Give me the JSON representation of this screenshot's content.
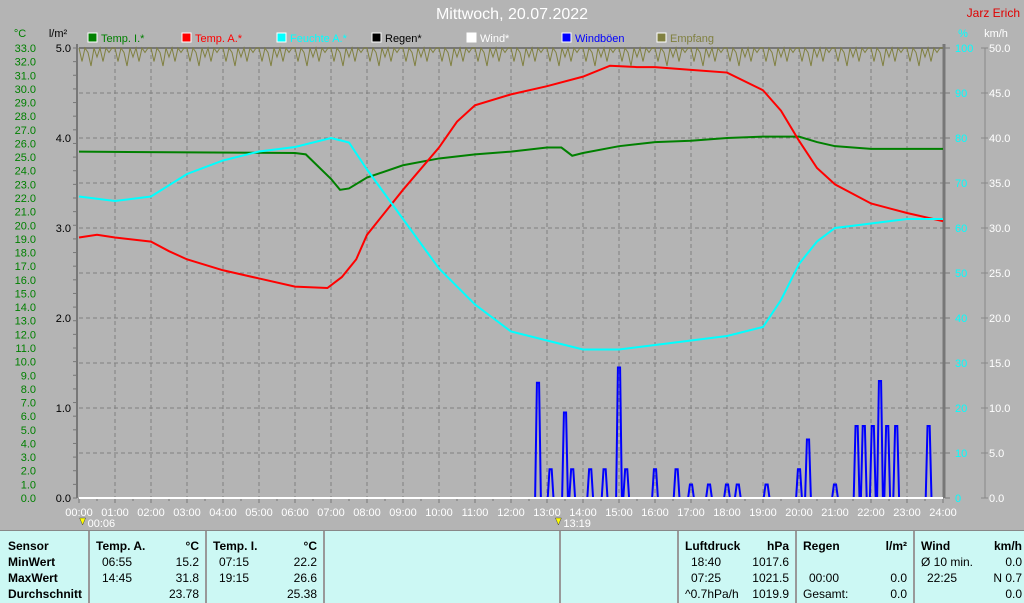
{
  "header": {
    "title": "Mittwoch, 20.07.2022",
    "author": "Jarz Erich"
  },
  "chart_data": {
    "type": "line",
    "title": "Mittwoch, 20.07.2022",
    "x_label_ticks": [
      "00:00",
      "01:00",
      "02:00",
      "03:00",
      "04:00",
      "05:00",
      "06:00",
      "07:00",
      "08:00",
      "09:00",
      "10:00",
      "11:00",
      "12:00",
      "13:00",
      "14:00",
      "15:00",
      "16:00",
      "17:00",
      "18:00",
      "19:00",
      "20:00",
      "21:00",
      "22:00",
      "23:00",
      "24:00"
    ],
    "xlim": [
      0,
      24
    ],
    "axes": {
      "temp": {
        "unit": "°C",
        "range": [
          0,
          33
        ],
        "ticks": [
          "0.0",
          "1.0",
          "2.0",
          "3.0",
          "4.0",
          "5.0",
          "6.0",
          "7.0",
          "8.0",
          "9.0",
          "10.0",
          "11.0",
          "12.0",
          "13.0",
          "14.0",
          "15.0",
          "16.0",
          "17.0",
          "18.0",
          "19.0",
          "20.0",
          "21.0",
          "22.0",
          "23.0",
          "24.0",
          "25.0",
          "26.0",
          "27.0",
          "28.0",
          "29.0",
          "30.0",
          "31.0",
          "32.0",
          "33.0"
        ]
      },
      "rain": {
        "unit": "l/m²",
        "range": [
          0,
          5
        ],
        "ticks": [
          "0.0",
          "1.0",
          "2.0",
          "3.0",
          "4.0",
          "5.0"
        ]
      },
      "humidity": {
        "unit": "%",
        "range": [
          0,
          100
        ],
        "ticks": [
          "0",
          "10",
          "20",
          "30",
          "40",
          "50",
          "60",
          "70",
          "80",
          "90",
          "100"
        ]
      },
      "wind": {
        "unit": "km/h",
        "range": [
          0,
          50
        ],
        "ticks": [
          "0.0",
          "5.0",
          "10.0",
          "15.0",
          "20.0",
          "25.0",
          "30.0",
          "35.0",
          "40.0",
          "45.0",
          "50.0"
        ]
      }
    },
    "legend": [
      {
        "label": "Temp. I.*",
        "color": "#008000"
      },
      {
        "label": "Temp. A.*",
        "color": "#ff0000"
      },
      {
        "label": "Feuchte A.*",
        "color": "#00ffff"
      },
      {
        "label": "Regen*",
        "color": "#000000"
      },
      {
        "label": "Wind*",
        "color": "#ffffff"
      },
      {
        "label": "Windböen",
        "color": "#0000ff"
      },
      {
        "label": "Empfang",
        "color": "#808040"
      }
    ],
    "series": [
      {
        "name": "Temp. I.*",
        "axis": "temp",
        "color": "#008000",
        "x": [
          0,
          6,
          6.3,
          7,
          7.25,
          7.5,
          8,
          9,
          10,
          11,
          12,
          13,
          13.4,
          13.7,
          14,
          15,
          16,
          17,
          18,
          19,
          20,
          20.5,
          21,
          22,
          24
        ],
        "y": [
          25.4,
          25.3,
          25.2,
          23.4,
          22.6,
          22.7,
          23.5,
          24.4,
          24.9,
          25.2,
          25.4,
          25.7,
          25.7,
          25.1,
          25.3,
          25.8,
          26.1,
          26.2,
          26.4,
          26.5,
          26.5,
          26.1,
          25.8,
          25.6,
          25.6
        ]
      },
      {
        "name": "Temp. A.*",
        "axis": "temp",
        "color": "#ff0000",
        "x": [
          0,
          0.5,
          1,
          2,
          2.5,
          3,
          4,
          5,
          6,
          6.9,
          7.3,
          7.7,
          8,
          9,
          10,
          10.5,
          11,
          12,
          13,
          14,
          14.75,
          15.5,
          16,
          17,
          18,
          19,
          19.5,
          20,
          20.5,
          21,
          22,
          23,
          24
        ],
        "y": [
          19.1,
          19.3,
          19.1,
          18.8,
          18.1,
          17.5,
          16.7,
          16.1,
          15.5,
          15.4,
          16.2,
          17.5,
          19.3,
          22.6,
          25.7,
          27.6,
          28.8,
          29.6,
          30.2,
          30.9,
          31.7,
          31.6,
          31.6,
          31.4,
          31.2,
          29.9,
          28.4,
          26.2,
          24.2,
          23.0,
          21.6,
          20.9,
          20.3
        ]
      },
      {
        "name": "Feuchte A.*",
        "axis": "humidity",
        "color": "#00ffff",
        "x": [
          0,
          1,
          2,
          3,
          4,
          5,
          6,
          7,
          7.5,
          8,
          9,
          10,
          11,
          12,
          13,
          14,
          15,
          16,
          17,
          18,
          19,
          19.5,
          20,
          20.5,
          21,
          22,
          23,
          24
        ],
        "y": [
          67,
          66,
          67,
          72,
          75,
          77,
          78,
          80,
          79,
          73,
          62,
          51,
          43,
          37,
          35,
          33,
          33,
          34,
          35,
          36,
          38,
          44,
          52,
          57,
          60,
          61,
          62,
          62
        ]
      },
      {
        "name": "Regen*",
        "axis": "rain",
        "color": "#000000",
        "x": [
          0,
          24
        ],
        "y": [
          0,
          0
        ]
      },
      {
        "name": "Windböen",
        "axis": "wind",
        "color": "#0000ff",
        "peaks_x": [
          12.75,
          13.1,
          13.5,
          13.7,
          14.2,
          14.6,
          15,
          15.2,
          16,
          16.6,
          17,
          17.5,
          18,
          18.3,
          19.1,
          20,
          20.25,
          21,
          21.6,
          21.8,
          22.05,
          22.25,
          22.45,
          22.7,
          23.6
        ],
        "peaks_y": [
          12.8,
          3.2,
          9.5,
          3.2,
          3.2,
          3.2,
          14.5,
          3.2,
          3.2,
          3.2,
          1.5,
          1.5,
          1.5,
          1.5,
          1.5,
          3.2,
          6.5,
          1.5,
          8,
          8,
          8,
          13,
          8,
          8,
          8
        ]
      },
      {
        "name": "Wind*",
        "axis": "wind",
        "color": "#ffffff",
        "x": [
          0,
          24
        ],
        "y": [
          0,
          0
        ]
      },
      {
        "name": "Empfang",
        "axis": "humidity",
        "color": "#808040",
        "pattern": [
          100,
          97,
          100,
          99,
          96,
          100,
          98,
          100,
          97,
          100,
          99,
          100
        ]
      }
    ],
    "markers": [
      {
        "time": "00:06",
        "label": "00:06"
      },
      {
        "time": "13:19",
        "label": "13:19"
      }
    ]
  },
  "table": {
    "sensor": {
      "h": "Sensor",
      "min": "MinWert",
      "max": "MaxWert",
      "avg": "Durchschnitt"
    },
    "tempA": {
      "h": "Temp. A.",
      "u": "°C",
      "min_t": "06:55",
      "min": "15.2",
      "max_t": "14:45",
      "max": "31.8",
      "avg": "23.78"
    },
    "tempI": {
      "h": "Temp. I.",
      "u": "°C",
      "min_t": "07:15",
      "min": "22.2",
      "max_t": "19:15",
      "max": "26.6",
      "avg": "25.38"
    },
    "press": {
      "h": "Luftdruck",
      "u": "hPa",
      "min_t": "18:40",
      "min": "1017.6",
      "max_t": "07:25",
      "max": "1021.5",
      "trend": "^0.7hPa/h",
      "avg": "1019.9"
    },
    "rain": {
      "h": "Regen",
      "u": "l/m²",
      "max_t": "00:00",
      "max": "0.0",
      "total_l": "Gesamt:",
      "total": "0.0"
    },
    "wind": {
      "h": "Wind",
      "u": "km/h",
      "avg_l": "Ø 10 min.",
      "avg": "0.0",
      "max_t": "22:25",
      "max": "N 0.7",
      "day": "0.0"
    }
  }
}
